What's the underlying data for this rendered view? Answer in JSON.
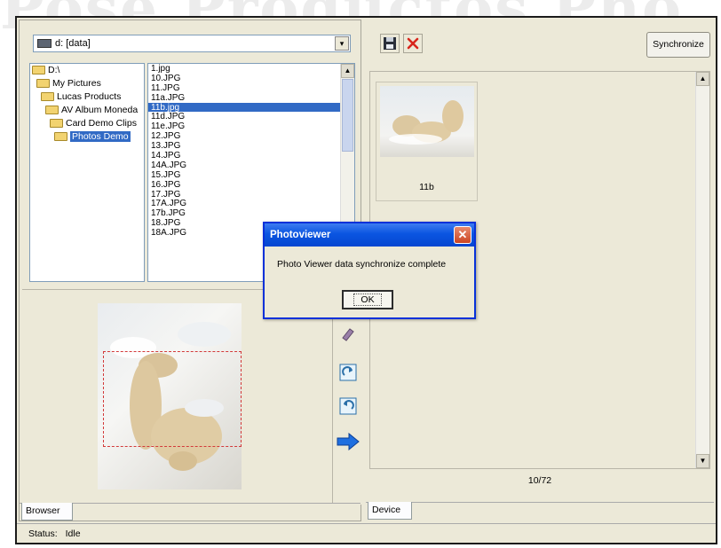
{
  "watermark": {
    "text": "Pose  Productos  Pho"
  },
  "browser": {
    "drive": "d: [data]",
    "tree": [
      {
        "label": "D:\\",
        "level": 0,
        "selected": false
      },
      {
        "label": "My Pictures",
        "level": 1,
        "selected": false
      },
      {
        "label": "Lucas Products",
        "level": 2,
        "selected": false
      },
      {
        "label": "AV Album Moneda",
        "level": 3,
        "selected": false
      },
      {
        "label": "Card Demo Clips",
        "level": 4,
        "selected": false
      },
      {
        "label": "Photos Demo",
        "level": 5,
        "selected": true
      }
    ],
    "files": [
      "1.jpg",
      "10.JPG",
      "11.JPG",
      "11a.JPG",
      "11b.jpg",
      "11d.JPG",
      "11e.JPG",
      "12.JPG",
      "13.JPG",
      "14.JPG",
      "14A.JPG",
      "15.JPG",
      "16.JPG",
      "17.JPG",
      "17A.JPG",
      "17b.JPG",
      "18.JPG",
      "18A.JPG"
    ],
    "selected_file": "11b.jpg",
    "tab": "Browser"
  },
  "device": {
    "synchronize_label": "Synchronize",
    "thumbnails": [
      {
        "label": "11b"
      }
    ],
    "counter": "10/72",
    "tab": "Device"
  },
  "status": {
    "label": "Status:",
    "value": "Idle"
  },
  "dialog": {
    "title": "Photoviewer",
    "message": "Photo Viewer data synchronize complete",
    "ok_label": "OK"
  },
  "icons": {
    "save": "floppy-disk-icon",
    "delete": "red-x-icon",
    "eraser": "eraser-icon",
    "rotate_right": "rotate-right-icon",
    "rotate_left": "rotate-left-icon",
    "send": "blue-arrow-right-icon"
  },
  "colors": {
    "window_bg": "#ece9d8",
    "selection": "#316ac5",
    "dialog_title": "#0a55e1",
    "crop_rect": "#d23a3a"
  }
}
